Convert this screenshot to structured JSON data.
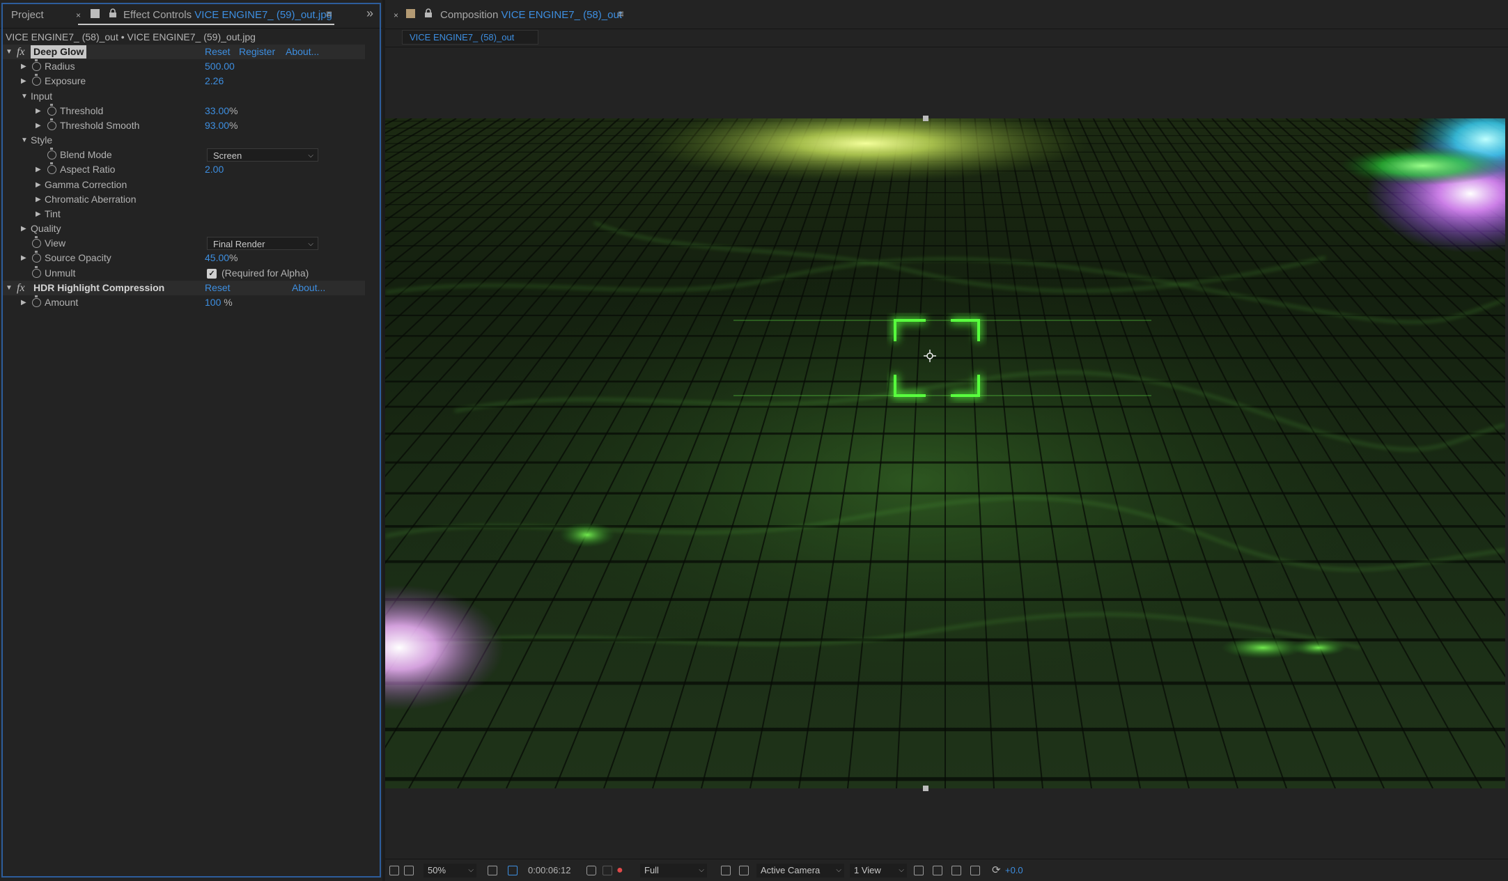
{
  "left_panel": {
    "project_tab": "Project",
    "effect_controls_tab": {
      "label": "Effect Controls",
      "layer": "VICE ENGINE7_ (59)_out.jpg"
    },
    "layer_path": "VICE ENGINE7_ (58)_out • VICE ENGINE7_ (59)_out.jpg"
  },
  "effects": {
    "deep_glow": {
      "name": "Deep Glow",
      "reset": "Reset",
      "register": "Register",
      "about": "About...",
      "radius": {
        "label": "Radius",
        "value": "500.00"
      },
      "exposure": {
        "label": "Exposure",
        "value": "2.26"
      },
      "input": {
        "label": "Input",
        "threshold": {
          "label": "Threshold",
          "value": "33.00",
          "unit": "%"
        },
        "threshold_smooth": {
          "label": "Threshold Smooth",
          "value": "93.00",
          "unit": "%"
        }
      },
      "style": {
        "label": "Style",
        "blend_mode": {
          "label": "Blend Mode",
          "value": "Screen"
        },
        "aspect_ratio": {
          "label": "Aspect Ratio",
          "value": "2.00"
        },
        "gamma_correction": "Gamma Correction",
        "chromatic_aberration": "Chromatic Aberration",
        "tint": "Tint"
      },
      "quality": "Quality",
      "view": {
        "label": "View",
        "value": "Final Render"
      },
      "source_opacity": {
        "label": "Source Opacity",
        "value": "45.00",
        "unit": "%"
      },
      "unmult": {
        "label": "Unmult",
        "checkbox_label": "(Required for Alpha)",
        "checked": true
      }
    },
    "hdr": {
      "name": "HDR Highlight Compression",
      "reset": "Reset",
      "about": "About...",
      "amount": {
        "label": "Amount",
        "value": "100",
        "unit": "%"
      }
    }
  },
  "comp_panel": {
    "tab_label": "Composition",
    "comp_name": "VICE ENGINE7_ (58)_out",
    "subtab": "VICE ENGINE7_ (58)_out"
  },
  "toolbar": {
    "zoom": "50%",
    "timecode": "0:00:06:12",
    "resolution": "Full",
    "camera": "Active Camera",
    "views": "1 View",
    "exposure": "+0.0"
  },
  "colors": {
    "accent_blue": "#3d8ee0",
    "panel_focus_border": "#2d5d9c",
    "panel_bg": "#232323"
  }
}
